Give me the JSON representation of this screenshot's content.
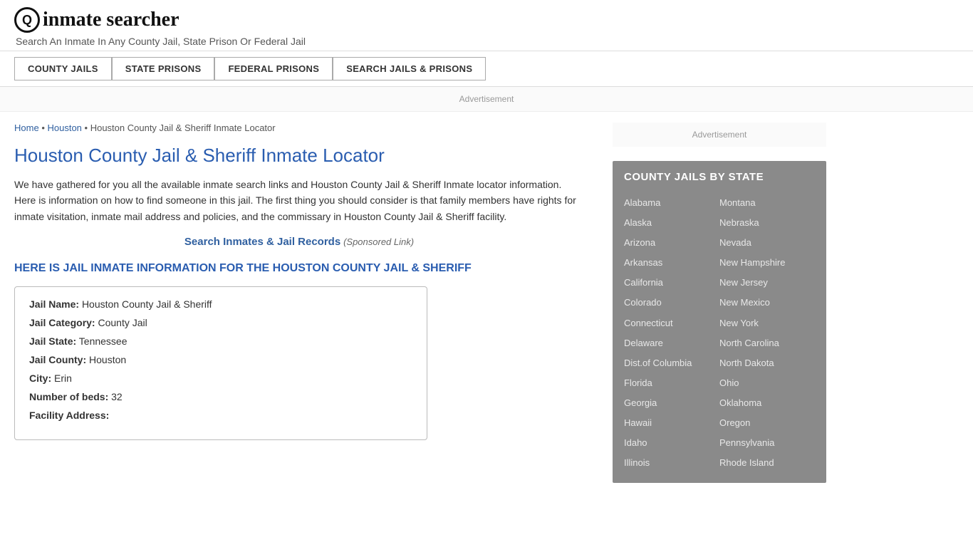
{
  "header": {
    "logo_icon": "🔍",
    "logo_text": "inmate searcher",
    "tagline": "Search An Inmate In Any County Jail, State Prison Or Federal Jail"
  },
  "nav": {
    "buttons": [
      {
        "id": "county-jails",
        "label": "COUNTY JAILS"
      },
      {
        "id": "state-prisons",
        "label": "STATE PRISONS"
      },
      {
        "id": "federal-prisons",
        "label": "FEDERAL PRISONS"
      },
      {
        "id": "search-jails",
        "label": "SEARCH JAILS & PRISONS"
      }
    ]
  },
  "ad": {
    "label": "Advertisement"
  },
  "breadcrumb": {
    "home": "Home",
    "city": "Houston",
    "page": "Houston County Jail & Sheriff Inmate Locator"
  },
  "main": {
    "title": "Houston County Jail & Sheriff Inmate Locator",
    "description": "We have gathered for you all the available inmate search links and Houston County Jail & Sheriff Inmate locator information. Here is information on how to find someone in this jail. The first thing you should consider is that family members have rights for inmate visitation, inmate mail address and policies, and the commissary in Houston County Jail & Sheriff facility.",
    "search_link_text": "Search Inmates & Jail Records",
    "search_link_sponsored": "(Sponsored Link)",
    "section_heading": "HERE IS JAIL INMATE INFORMATION FOR THE HOUSTON COUNTY JAIL & SHERIFF",
    "info": {
      "jail_name_label": "Jail Name:",
      "jail_name_value": "Houston County Jail & Sheriff",
      "jail_category_label": "Jail Category:",
      "jail_category_value": "County Jail",
      "jail_state_label": "Jail State:",
      "jail_state_value": "Tennessee",
      "jail_county_label": "Jail County:",
      "jail_county_value": "Houston",
      "city_label": "City:",
      "city_value": "Erin",
      "beds_label": "Number of beds:",
      "beds_value": "32",
      "address_label": "Facility Address:"
    }
  },
  "sidebar": {
    "ad_label": "Advertisement",
    "county_jails_title": "COUNTY JAILS BY STATE",
    "states_col1": [
      "Alabama",
      "Alaska",
      "Arizona",
      "Arkansas",
      "California",
      "Colorado",
      "Connecticut",
      "Delaware",
      "Dist.of Columbia",
      "Florida",
      "Georgia",
      "Hawaii",
      "Idaho",
      "Illinois"
    ],
    "states_col2": [
      "Montana",
      "Nebraska",
      "Nevada",
      "New Hampshire",
      "New Jersey",
      "New Mexico",
      "New York",
      "North Carolina",
      "North Dakota",
      "Ohio",
      "Oklahoma",
      "Oregon",
      "Pennsylvania",
      "Rhode Island"
    ]
  }
}
